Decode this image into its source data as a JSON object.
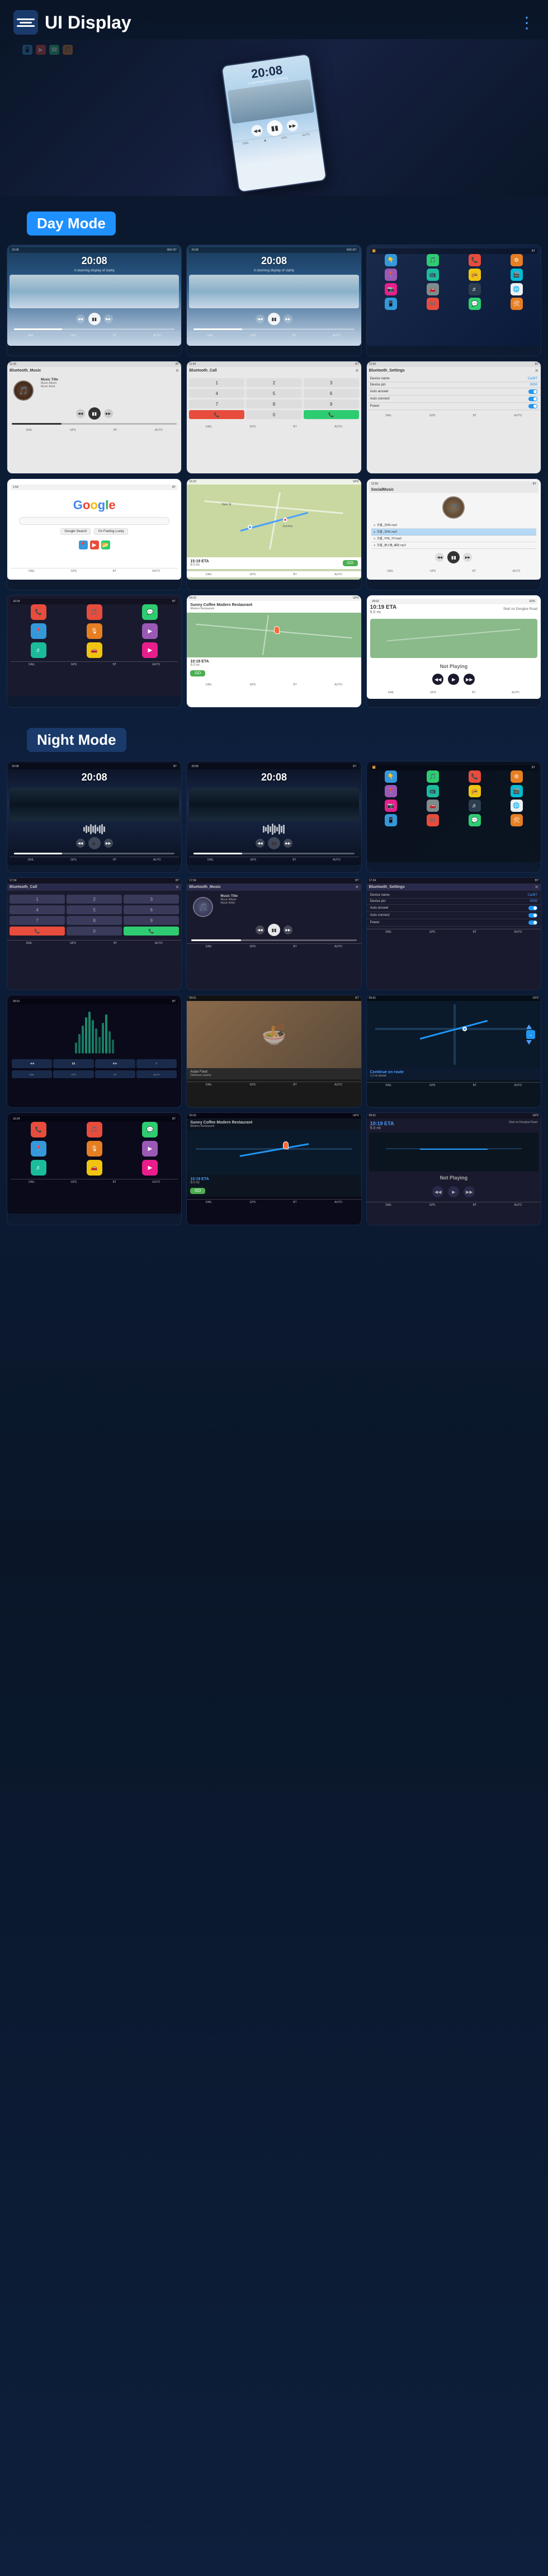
{
  "header": {
    "title": "UI Display",
    "menu_icon": "≡",
    "dots_icon": "⋮"
  },
  "modes": {
    "day": "Day Mode",
    "night": "Night Mode"
  },
  "hero": {
    "time": "20:08",
    "subtitle": "A stunning display of clarity"
  },
  "day_screens": [
    {
      "id": "day-player-1",
      "type": "music_player",
      "time": "20:08",
      "subtitle": "A stunning display of clarity",
      "theme": "day"
    },
    {
      "id": "day-player-2",
      "type": "music_player",
      "time": "20:08",
      "subtitle": "A stunning display of clarity",
      "theme": "day"
    },
    {
      "id": "day-apps",
      "type": "app_grid",
      "theme": "day"
    },
    {
      "id": "day-bt-music",
      "type": "bluetooth_music",
      "header": "Bluetooth_Music",
      "track": "Music Title",
      "album": "Music Album",
      "artist": "Music Artist",
      "theme": "day"
    },
    {
      "id": "day-bt-call",
      "type": "bluetooth_call",
      "header": "Bluetooth_Call",
      "theme": "day"
    },
    {
      "id": "day-bt-settings",
      "type": "bluetooth_settings",
      "header": "Bluetooth_Settings",
      "device_name_label": "Device name",
      "device_name_val": "CarBT",
      "device_pin_label": "Device pin",
      "device_pin_val": "0000",
      "auto_answer": "Auto answer",
      "auto_connect": "Auto connect",
      "power": "Power",
      "theme": "day"
    },
    {
      "id": "day-google",
      "type": "google",
      "theme": "day"
    },
    {
      "id": "day-map",
      "type": "map",
      "theme": "day"
    },
    {
      "id": "day-social-music",
      "type": "social_music",
      "header": "SocialMusic",
      "theme": "day"
    },
    {
      "id": "day-carplay-apps",
      "type": "carplay_apps",
      "theme": "day"
    },
    {
      "id": "day-nav",
      "type": "navigation",
      "poi": "Sunny Coffee Modern Restaurant",
      "theme": "day"
    },
    {
      "id": "day-not-playing",
      "type": "not_playing",
      "time": "10:19 ETA",
      "distance": "9.0 mi",
      "route": "Start on Donglue Road",
      "label": "Not Playing",
      "theme": "day"
    }
  ],
  "night_screens": [
    {
      "id": "night-player-1",
      "type": "music_player",
      "time": "20:08",
      "theme": "night"
    },
    {
      "id": "night-player-2",
      "type": "music_player",
      "time": "20:08",
      "theme": "night"
    },
    {
      "id": "night-apps",
      "type": "app_grid",
      "theme": "night"
    },
    {
      "id": "night-bt-call",
      "type": "bluetooth_call",
      "header": "Bluetooth_Call",
      "theme": "night"
    },
    {
      "id": "night-bt-music",
      "type": "bluetooth_music",
      "header": "Bluetooth_Music",
      "track": "Music Title",
      "album": "Music Album",
      "artist": "Music Artist",
      "theme": "night"
    },
    {
      "id": "night-bt-settings",
      "type": "bluetooth_settings",
      "header": "Bluetooth_Settings",
      "device_name_label": "Device name",
      "device_name_val": "CarBT",
      "device_pin_label": "Device pin",
      "device_pin_val": "0000",
      "auto_answer": "Auto answer",
      "auto_connect": "Auto connect",
      "power": "Power",
      "theme": "night"
    },
    {
      "id": "night-waveform",
      "type": "waveform",
      "theme": "night"
    },
    {
      "id": "night-food",
      "type": "food_image",
      "theme": "night"
    },
    {
      "id": "night-map-nav",
      "type": "map_nav",
      "theme": "night"
    },
    {
      "id": "night-carplay-apps",
      "type": "carplay_apps",
      "theme": "night"
    },
    {
      "id": "night-nav",
      "type": "navigation",
      "poi": "Sunny Coffee Modern Restaurant",
      "theme": "night"
    },
    {
      "id": "night-not-playing",
      "type": "not_playing",
      "time": "10:19 ETA",
      "distance": "9.0 mi",
      "route": "Start on Donglue Road",
      "label": "Not Playing",
      "theme": "night"
    }
  ],
  "music_label": {
    "track": "Music Title",
    "album": "Music Album",
    "artist": "Music Artist"
  },
  "nav_info": {
    "poi_name": "Sunny Coffee Modern Restaurant",
    "eta_label": "10:19 ETA",
    "distance": "9.0 mi",
    "route_start": "Start on Donglue Road",
    "not_playing": "Not Playing"
  }
}
